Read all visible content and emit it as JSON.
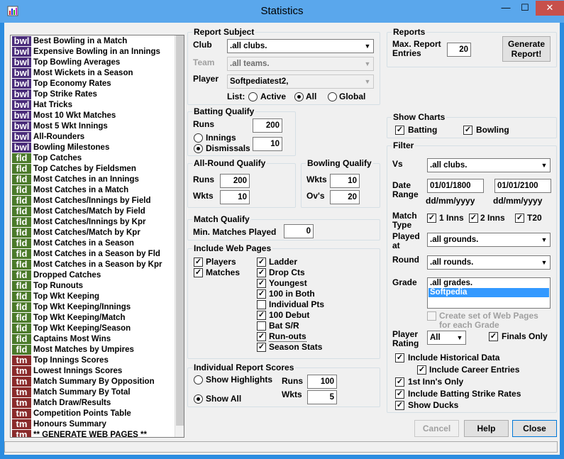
{
  "window": {
    "title": "Statistics",
    "min": "—",
    "max": "☐",
    "close": "✕"
  },
  "reports_list": [
    {
      "tag": "bwl",
      "label": "Best Bowling in a Match"
    },
    {
      "tag": "bwl",
      "label": "Expensive Bowling in an Innings"
    },
    {
      "tag": "bwl",
      "label": "Top Bowling Averages"
    },
    {
      "tag": "bwl",
      "label": "Most Wickets in a Season"
    },
    {
      "tag": "bwl",
      "label": "Top Economy Rates"
    },
    {
      "tag": "bwl",
      "label": "Top Strike Rates"
    },
    {
      "tag": "bwl",
      "label": "Hat Tricks"
    },
    {
      "tag": "bwl",
      "label": "Most 10 Wkt Matches"
    },
    {
      "tag": "bwl",
      "label": "Most 5 Wkt Innings"
    },
    {
      "tag": "bwl",
      "label": "All-Rounders"
    },
    {
      "tag": "bwl",
      "label": "Bowling Milestones"
    },
    {
      "tag": "fld",
      "label": "Top Catches"
    },
    {
      "tag": "fld",
      "label": "Top Catches by Fieldsmen"
    },
    {
      "tag": "fld",
      "label": "Most Catches in an Innings"
    },
    {
      "tag": "fld",
      "label": "Most Catches in a Match"
    },
    {
      "tag": "fld",
      "label": "Most Catches/Innings by Field"
    },
    {
      "tag": "fld",
      "label": "Most Catches/Match by Field"
    },
    {
      "tag": "fld",
      "label": "Most Catches/Innings by Kpr"
    },
    {
      "tag": "fld",
      "label": "Most Catches/Match by Kpr"
    },
    {
      "tag": "fld",
      "label": "Most Catches in a Season"
    },
    {
      "tag": "fld",
      "label": "Most Catches in a Season by Fld"
    },
    {
      "tag": "fld",
      "label": "Most Catches in a Season by Kpr"
    },
    {
      "tag": "fld",
      "label": "Dropped Catches"
    },
    {
      "tag": "fld",
      "label": "Top Runouts"
    },
    {
      "tag": "fld",
      "label": "Top Wkt Keeping"
    },
    {
      "tag": "fld",
      "label": "Top Wkt Keeping/Innings"
    },
    {
      "tag": "fld",
      "label": "Top Wkt Keeping/Match"
    },
    {
      "tag": "fld",
      "label": "Top Wkt Keeping/Season"
    },
    {
      "tag": "fld",
      "label": "Captains Most Wins"
    },
    {
      "tag": "fld",
      "label": "Most Matches by Umpires"
    },
    {
      "tag": "tm",
      "label": "Top Innings Scores"
    },
    {
      "tag": "tm",
      "label": "Lowest Innings Scores"
    },
    {
      "tag": "tm",
      "label": "Match Summary By Opposition"
    },
    {
      "tag": "tm",
      "label": "Match Summary By Total"
    },
    {
      "tag": "tm",
      "label": "Match Draw/Results"
    },
    {
      "tag": "tm",
      "label": "Competition Points Table"
    },
    {
      "tag": "tm",
      "label": "Honours Summary"
    },
    {
      "tag": "tm",
      "label": "** GENERATE WEB PAGES **"
    }
  ],
  "report_subject": {
    "title": "Report Subject",
    "club_label": "Club",
    "club_value": ".all clubs.",
    "team_label": "Team",
    "team_value": ".all teams.",
    "player_label": "Player",
    "player_value": "Softpediatest2,",
    "list_label": "List:",
    "active": "Active",
    "all": "All",
    "global": "Global"
  },
  "batting_qualify": {
    "title": "Batting Qualify",
    "runs_label": "Runs",
    "runs": "200",
    "innings": "Innings",
    "dismissals": "Dismissals",
    "value": "10"
  },
  "allround_qualify": {
    "title": "All-Round Qualify",
    "runs_label": "Runs",
    "runs": "200",
    "wkts_label": "Wkts",
    "wkts": "10"
  },
  "bowling_qualify": {
    "title": "Bowling Qualify",
    "wkts_label": "Wkts",
    "wkts": "10",
    "ovs_label": "Ov's",
    "ovs": "20"
  },
  "match_qualify": {
    "title": "Match Qualify",
    "min_label": "Min. Matches Played",
    "min": "0"
  },
  "web_pages": {
    "title": "Include Web Pages",
    "players": "Players",
    "matches": "Matches",
    "ladder": "Ladder",
    "drop_cts": "Drop Cts",
    "youngest": "Youngest",
    "100_both": "100 in Both",
    "indiv_pts": "Individual Pts",
    "100_debut": "100 Debut",
    "bat_sr": "Bat S/R",
    "run_outs": "Run-outs",
    "season_stats": "Season Stats"
  },
  "indiv_scores": {
    "title": "Individual Report Scores",
    "show_highlights": "Show Highlights",
    "show_all": "Show All",
    "runs_label": "Runs",
    "runs": "100",
    "wkts_label": "Wkts",
    "wkts": "5"
  },
  "reports": {
    "title": "Reports",
    "max_label_1": "Max. Report",
    "max_label_2": "Entries",
    "max_value": "20",
    "generate_1": "Generate",
    "generate_2": "Report!"
  },
  "show_charts": {
    "title": "Show Charts",
    "batting": "Batting",
    "bowling": "Bowling"
  },
  "filter": {
    "title": "Filter",
    "vs_label": "Vs",
    "vs_value": ".all clubs.",
    "date_label_1": "Date",
    "date_label_2": "Range",
    "date_from": "01/01/1800",
    "date_to": "01/01/2100",
    "date_fmt": "dd/mm/yyyy",
    "match_type_1": "Match",
    "match_type_2": "Type",
    "inns1": "1 Inns",
    "inns2": "2 Inns",
    "t20": "T20",
    "played_1": "Played",
    "played_2": "at",
    "played_value": ".all grounds.",
    "round_label": "Round",
    "round_value": ".all rounds.",
    "grade_label": "Grade",
    "grades": [
      ".all grades.",
      "Softpedia"
    ],
    "create_set_1": "Create set of Web Pages",
    "create_set_2": "for each Grade",
    "player_rating_1": "Player",
    "player_rating_2": "Rating",
    "rating_value": "All",
    "finals_only": "Finals Only",
    "hist": "Include Historical Data",
    "career": "Include Career Entries",
    "first_inn": "1st Inn's Only",
    "strike": "Include Batting Strike Rates",
    "ducks": "Show Ducks"
  },
  "buttons": {
    "cancel": "Cancel",
    "help": "Help",
    "close": "Close"
  },
  "colors": {
    "titlebar": "#5aa7ec",
    "bwl": "#4a2c7a",
    "fld": "#4b7a2a",
    "tm": "#8a2b2b",
    "selection": "#3399ff"
  }
}
